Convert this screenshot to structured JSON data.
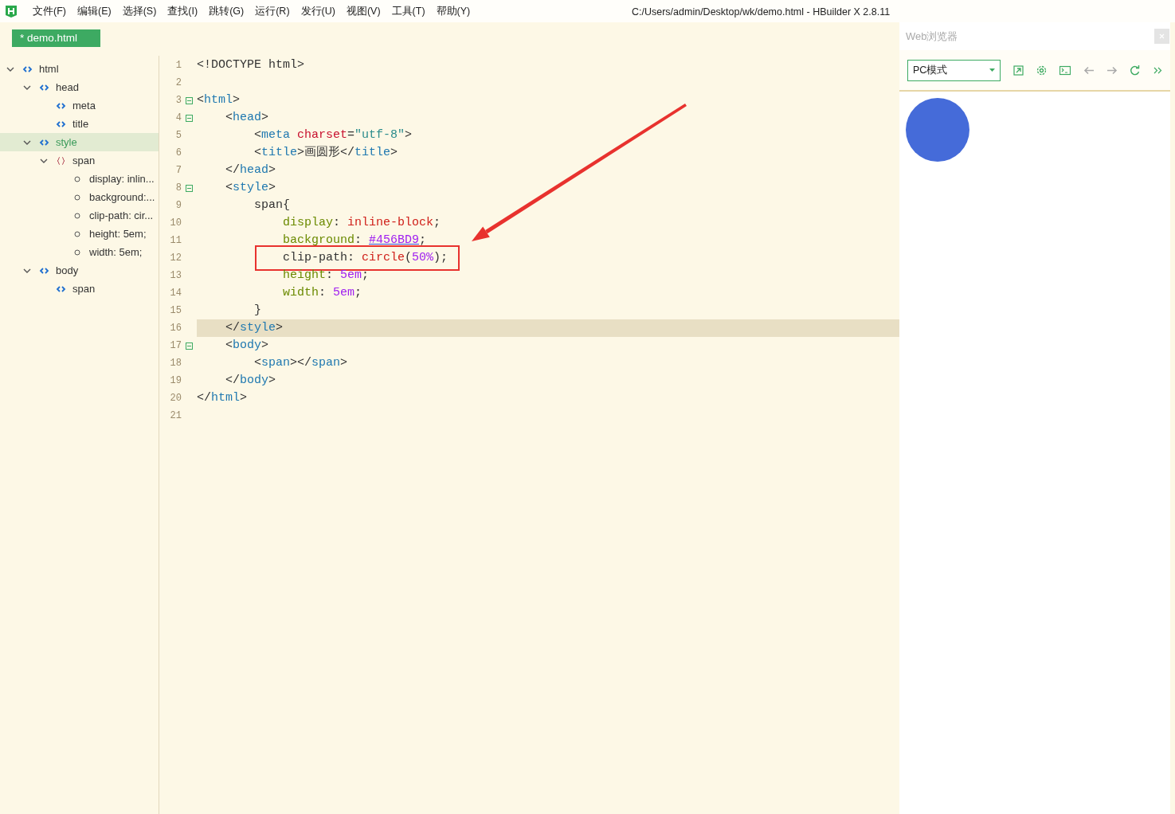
{
  "menu": [
    "文件(F)",
    "编辑(E)",
    "选择(S)",
    "查找(I)",
    "跳转(G)",
    "运行(R)",
    "发行(U)",
    "视图(V)",
    "工具(T)",
    "帮助(Y)"
  ],
  "window": {
    "title": "C:/Users/admin/Desktop/wk/demo.html - HBuilder X 2.8.11"
  },
  "tabs": [
    {
      "label": "* demo.html",
      "selected": true
    }
  ],
  "outline": [
    {
      "kind": "tag",
      "label": "html",
      "expanded": true,
      "selected": false,
      "children": [
        {
          "kind": "tag",
          "label": "head",
          "expanded": true,
          "selected": false,
          "children": [
            {
              "kind": "tag",
              "label": "meta",
              "selected": false
            },
            {
              "kind": "tag",
              "label": "title",
              "selected": false
            }
          ]
        },
        {
          "kind": "tag",
          "label": "style",
          "expanded": true,
          "selected": true,
          "children": [
            {
              "kind": "rule",
              "label": "span",
              "expanded": true,
              "selected": false,
              "children": [
                {
                  "kind": "property",
                  "label": "display: inlin...",
                  "selected": false
                },
                {
                  "kind": "property",
                  "label": "background:...",
                  "selected": false
                },
                {
                  "kind": "property",
                  "label": "clip-path: cir...",
                  "selected": false
                },
                {
                  "kind": "property",
                  "label": "height: 5em;",
                  "selected": false
                },
                {
                  "kind": "property",
                  "label": "width: 5em;",
                  "selected": false
                }
              ]
            }
          ]
        },
        {
          "kind": "tag",
          "label": "body",
          "expanded": true,
          "selected": false,
          "children": [
            {
              "kind": "tag",
              "label": "span",
              "selected": false
            }
          ]
        }
      ]
    }
  ],
  "editor": {
    "lines": [
      {
        "number": "1",
        "tokens": [
          {
            "kind": "punct",
            "text": "<!DOCTYPE html>"
          }
        ]
      },
      {
        "number": "2"
      },
      {
        "number": "3",
        "foldable": true,
        "tokens": [
          {
            "kind": "punct",
            "text": "<"
          },
          {
            "kind": "tag",
            "text": "html"
          },
          {
            "kind": "punct",
            "text": ">"
          }
        ]
      },
      {
        "number": "4",
        "foldable": true,
        "tokens": [
          {
            "kind": "punct",
            "text": "    <"
          },
          {
            "kind": "tag",
            "text": "head"
          },
          {
            "kind": "punct",
            "text": ">"
          }
        ]
      },
      {
        "number": "5",
        "tokens": [
          {
            "kind": "punct",
            "text": "        <"
          },
          {
            "kind": "tag",
            "text": "meta"
          },
          {
            "kind": "attr",
            "text": " charset"
          },
          {
            "kind": "punct",
            "text": "="
          },
          {
            "kind": "string",
            "text": "\"utf-8\""
          },
          {
            "kind": "punct",
            "text": ">"
          }
        ]
      },
      {
        "number": "6",
        "tokens": [
          {
            "kind": "punct",
            "text": "        <"
          },
          {
            "kind": "tag",
            "text": "title"
          },
          {
            "kind": "punct",
            "text": ">画圆形</"
          },
          {
            "kind": "tag",
            "text": "title"
          },
          {
            "kind": "punct",
            "text": ">"
          }
        ]
      },
      {
        "number": "7",
        "tokens": [
          {
            "kind": "punct",
            "text": "    </"
          },
          {
            "kind": "tag",
            "text": "head"
          },
          {
            "kind": "punct",
            "text": ">"
          }
        ]
      },
      {
        "number": "8",
        "foldable": true,
        "tokens": [
          {
            "kind": "punct",
            "text": "    <"
          },
          {
            "kind": "tag",
            "text": "style"
          },
          {
            "kind": "punct",
            "text": ">"
          }
        ]
      },
      {
        "number": "9",
        "tokens": [
          {
            "kind": "punct",
            "text": "        span{"
          }
        ]
      },
      {
        "number": "10",
        "tokens": [
          {
            "kind": "prop",
            "text": "            display"
          },
          {
            "kind": "punct",
            "text": ": "
          },
          {
            "kind": "value",
            "text": "inline-block"
          },
          {
            "kind": "punct",
            "text": ";"
          }
        ]
      },
      {
        "number": "11",
        "tokens": [
          {
            "kind": "prop",
            "text": "            background"
          },
          {
            "kind": "punct",
            "text": ": "
          },
          {
            "kind": "color",
            "text": "#456BD9"
          },
          {
            "kind": "punct",
            "text": ";"
          }
        ]
      },
      {
        "number": "12",
        "boxed": true,
        "tokens": [
          {
            "kind": "punct",
            "text": "            clip-path: "
          },
          {
            "kind": "value",
            "text": "circle"
          },
          {
            "kind": "punct",
            "text": "("
          },
          {
            "kind": "number",
            "text": "50%"
          },
          {
            "kind": "punct",
            "text": ");"
          }
        ]
      },
      {
        "number": "13",
        "tokens": [
          {
            "kind": "prop",
            "text": "            height"
          },
          {
            "kind": "punct",
            "text": ": "
          },
          {
            "kind": "number",
            "text": "5em"
          },
          {
            "kind": "punct",
            "text": ";"
          }
        ]
      },
      {
        "number": "14",
        "tokens": [
          {
            "kind": "prop",
            "text": "            width"
          },
          {
            "kind": "punct",
            "text": ": "
          },
          {
            "kind": "number",
            "text": "5em"
          },
          {
            "kind": "punct",
            "text": ";"
          }
        ]
      },
      {
        "number": "15",
        "tokens": [
          {
            "kind": "punct",
            "text": "        }"
          }
        ]
      },
      {
        "number": "16",
        "current": true,
        "tokens": [
          {
            "kind": "punct",
            "text": "    </"
          },
          {
            "kind": "tag",
            "text": "style"
          },
          {
            "kind": "punct",
            "text": ">"
          }
        ]
      },
      {
        "number": "17",
        "foldable": true,
        "tokens": [
          {
            "kind": "punct",
            "text": "    <"
          },
          {
            "kind": "tag",
            "text": "body"
          },
          {
            "kind": "punct",
            "text": ">"
          }
        ]
      },
      {
        "number": "18",
        "tokens": [
          {
            "kind": "punct",
            "text": "        <"
          },
          {
            "kind": "tag",
            "text": "span"
          },
          {
            "kind": "punct",
            "text": "></"
          },
          {
            "kind": "tag",
            "text": "span"
          },
          {
            "kind": "punct",
            "text": ">"
          }
        ]
      },
      {
        "number": "19",
        "tokens": [
          {
            "kind": "punct",
            "text": "    </"
          },
          {
            "kind": "tag",
            "text": "body"
          },
          {
            "kind": "punct",
            "text": ">"
          }
        ]
      },
      {
        "number": "20",
        "tokens": [
          {
            "kind": "punct",
            "text": "</"
          },
          {
            "kind": "tag",
            "text": "html"
          },
          {
            "kind": "punct",
            "text": ">"
          }
        ]
      },
      {
        "number": "21"
      }
    ]
  },
  "browser": {
    "title": "Web浏览器",
    "mode": "PC模式",
    "buttons": [
      {
        "kind": "open",
        "disabled": false
      },
      {
        "kind": "settings",
        "disabled": false
      },
      {
        "kind": "console",
        "disabled": false
      },
      {
        "kind": "back",
        "disabled": true
      },
      {
        "kind": "forward",
        "disabled": true
      },
      {
        "kind": "refresh",
        "disabled": false
      },
      {
        "kind": "more",
        "disabled": false
      }
    ]
  }
}
